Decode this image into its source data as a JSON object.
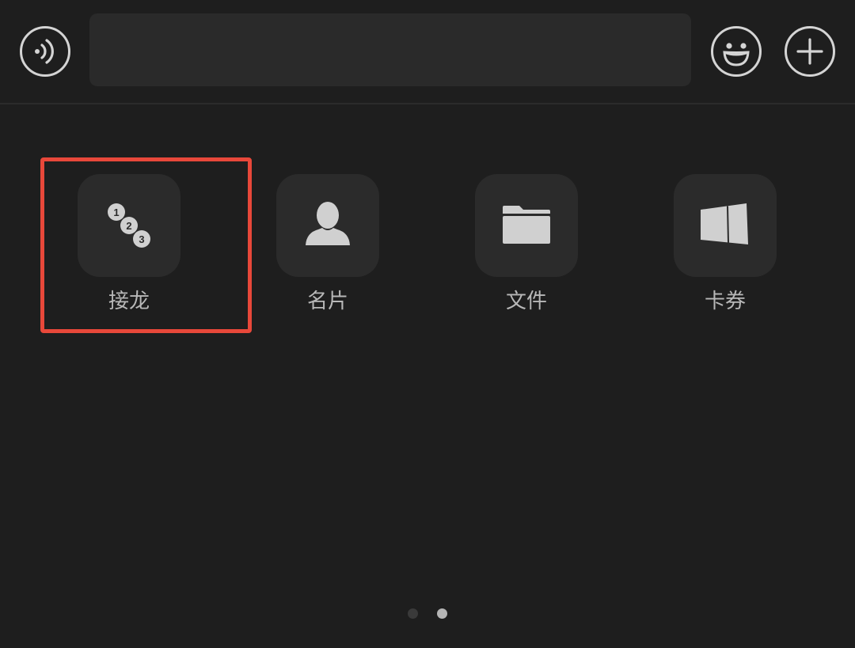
{
  "input_bar": {
    "voice_icon": "voice-icon",
    "emoji_icon": "emoji-icon",
    "plus_icon": "plus-icon",
    "text_value": ""
  },
  "panel": {
    "items": [
      {
        "label": "接龙",
        "icon": "numbered-list-icon"
      },
      {
        "label": "名片",
        "icon": "contact-card-icon"
      },
      {
        "label": "文件",
        "icon": "folder-icon"
      },
      {
        "label": "卡券",
        "icon": "coupon-icon"
      }
    ],
    "highlighted_item": "接龙",
    "highlight_color": "#e8483a",
    "pagination": {
      "total": 2,
      "current": 2
    }
  },
  "badges": {
    "n1": "1",
    "n2": "2",
    "n3": "3"
  }
}
